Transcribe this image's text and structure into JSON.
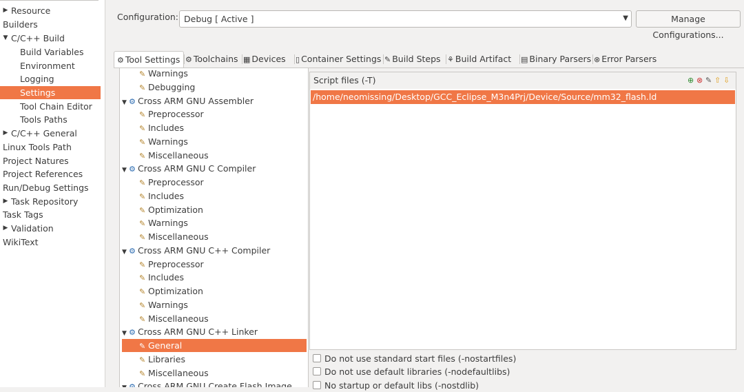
{
  "left_nav": {
    "items": [
      {
        "label": "Resource",
        "indent": 0,
        "arrow": "right",
        "selected": false
      },
      {
        "label": "Builders",
        "indent": 0,
        "arrow": "none",
        "selected": false
      },
      {
        "label": "C/C++ Build",
        "indent": 0,
        "arrow": "down",
        "selected": false
      },
      {
        "label": "Build Variables",
        "indent": 1,
        "arrow": "none",
        "selected": false
      },
      {
        "label": "Environment",
        "indent": 1,
        "arrow": "none",
        "selected": false
      },
      {
        "label": "Logging",
        "indent": 1,
        "arrow": "none",
        "selected": false
      },
      {
        "label": "Settings",
        "indent": 1,
        "arrow": "none",
        "selected": true
      },
      {
        "label": "Tool Chain Editor",
        "indent": 1,
        "arrow": "none",
        "selected": false
      },
      {
        "label": "Tools Paths",
        "indent": 1,
        "arrow": "none",
        "selected": false
      },
      {
        "label": "C/C++ General",
        "indent": 0,
        "arrow": "right",
        "selected": false
      },
      {
        "label": "Linux Tools Path",
        "indent": 0,
        "arrow": "none",
        "selected": false
      },
      {
        "label": "Project Natures",
        "indent": 0,
        "arrow": "none",
        "selected": false
      },
      {
        "label": "Project References",
        "indent": 0,
        "arrow": "none",
        "selected": false
      },
      {
        "label": "Run/Debug Settings",
        "indent": 0,
        "arrow": "none",
        "selected": false
      },
      {
        "label": "Task Repository",
        "indent": 0,
        "arrow": "right",
        "selected": false
      },
      {
        "label": "Task Tags",
        "indent": 0,
        "arrow": "none",
        "selected": false
      },
      {
        "label": "Validation",
        "indent": 0,
        "arrow": "right",
        "selected": false
      },
      {
        "label": "WikiText",
        "indent": 0,
        "arrow": "none",
        "selected": false
      }
    ]
  },
  "configuration": {
    "label": "Configuration:",
    "value": "Debug  [ Active ]",
    "manage_button": "Manage Configurations..."
  },
  "tabs": [
    {
      "label": "Tool Settings",
      "icon": "tool-settings-icon",
      "glyph": "⚙",
      "active": true
    },
    {
      "label": "Toolchains",
      "icon": "toolchains-icon",
      "glyph": "⚙",
      "active": false
    },
    {
      "label": "Devices",
      "icon": "devices-icon",
      "glyph": "▦",
      "active": false
    },
    {
      "label": "Container Settings",
      "icon": "container-icon",
      "glyph": "▯",
      "active": false
    },
    {
      "label": "Build Steps",
      "icon": "build-steps-icon",
      "glyph": "✎",
      "active": false
    },
    {
      "label": "Build Artifact",
      "icon": "build-artifact-icon",
      "glyph": "⚘",
      "active": false
    },
    {
      "label": "Binary Parsers",
      "icon": "binary-parsers-icon",
      "glyph": "▤",
      "active": false
    },
    {
      "label": "Error Parsers",
      "icon": "error-parsers-icon",
      "glyph": "⊗",
      "active": false
    }
  ],
  "tool_tree": {
    "items": [
      {
        "label": "Warnings",
        "level": 1,
        "kind": "option",
        "toggle": "none",
        "selected": false
      },
      {
        "label": "Debugging",
        "level": 1,
        "kind": "option",
        "toggle": "none",
        "selected": false
      },
      {
        "label": "Cross ARM GNU Assembler",
        "level": 0,
        "kind": "tool",
        "toggle": "down",
        "selected": false
      },
      {
        "label": "Preprocessor",
        "level": 1,
        "kind": "option",
        "toggle": "none",
        "selected": false
      },
      {
        "label": "Includes",
        "level": 1,
        "kind": "option",
        "toggle": "none",
        "selected": false
      },
      {
        "label": "Warnings",
        "level": 1,
        "kind": "option",
        "toggle": "none",
        "selected": false
      },
      {
        "label": "Miscellaneous",
        "level": 1,
        "kind": "option",
        "toggle": "none",
        "selected": false
      },
      {
        "label": "Cross ARM GNU C Compiler",
        "level": 0,
        "kind": "tool",
        "toggle": "down",
        "selected": false
      },
      {
        "label": "Preprocessor",
        "level": 1,
        "kind": "option",
        "toggle": "none",
        "selected": false
      },
      {
        "label": "Includes",
        "level": 1,
        "kind": "option",
        "toggle": "none",
        "selected": false
      },
      {
        "label": "Optimization",
        "level": 1,
        "kind": "option",
        "toggle": "none",
        "selected": false
      },
      {
        "label": "Warnings",
        "level": 1,
        "kind": "option",
        "toggle": "none",
        "selected": false
      },
      {
        "label": "Miscellaneous",
        "level": 1,
        "kind": "option",
        "toggle": "none",
        "selected": false
      },
      {
        "label": "Cross ARM GNU C++ Compiler",
        "level": 0,
        "kind": "tool",
        "toggle": "down",
        "selected": false
      },
      {
        "label": "Preprocessor",
        "level": 1,
        "kind": "option",
        "toggle": "none",
        "selected": false
      },
      {
        "label": "Includes",
        "level": 1,
        "kind": "option",
        "toggle": "none",
        "selected": false
      },
      {
        "label": "Optimization",
        "level": 1,
        "kind": "option",
        "toggle": "none",
        "selected": false
      },
      {
        "label": "Warnings",
        "level": 1,
        "kind": "option",
        "toggle": "none",
        "selected": false
      },
      {
        "label": "Miscellaneous",
        "level": 1,
        "kind": "option",
        "toggle": "none",
        "selected": false
      },
      {
        "label": "Cross ARM GNU C++ Linker",
        "level": 0,
        "kind": "tool",
        "toggle": "down",
        "selected": false
      },
      {
        "label": "General",
        "level": 1,
        "kind": "option",
        "toggle": "none",
        "selected": true
      },
      {
        "label": "Libraries",
        "level": 1,
        "kind": "option",
        "toggle": "none",
        "selected": false
      },
      {
        "label": "Miscellaneous",
        "level": 1,
        "kind": "option",
        "toggle": "none",
        "selected": false
      },
      {
        "label": "Cross ARM GNU Create Flash Image",
        "level": 0,
        "kind": "tool",
        "toggle": "down",
        "selected": false
      }
    ]
  },
  "script_files": {
    "label": "Script files (-T)",
    "entries": [
      "/home/neomissing/Desktop/GCC_Eclipse_M3n4Prj/Device/Source/mm32_flash.ld"
    ],
    "toolbar_icons": [
      "add-file-icon",
      "delete-file-icon",
      "edit-file-icon",
      "move-up-icon",
      "move-down-icon"
    ]
  },
  "options": [
    {
      "label": "Do not use standard start files (-nostartfiles)",
      "checked": false
    },
    {
      "label": "Do not use default libraries (-nodefaultlibs)",
      "checked": false
    },
    {
      "label": "No startup or default libs (-nostdlib)",
      "checked": false
    }
  ],
  "colors": {
    "selection": "#f07746",
    "background": "#f2f1f0"
  }
}
